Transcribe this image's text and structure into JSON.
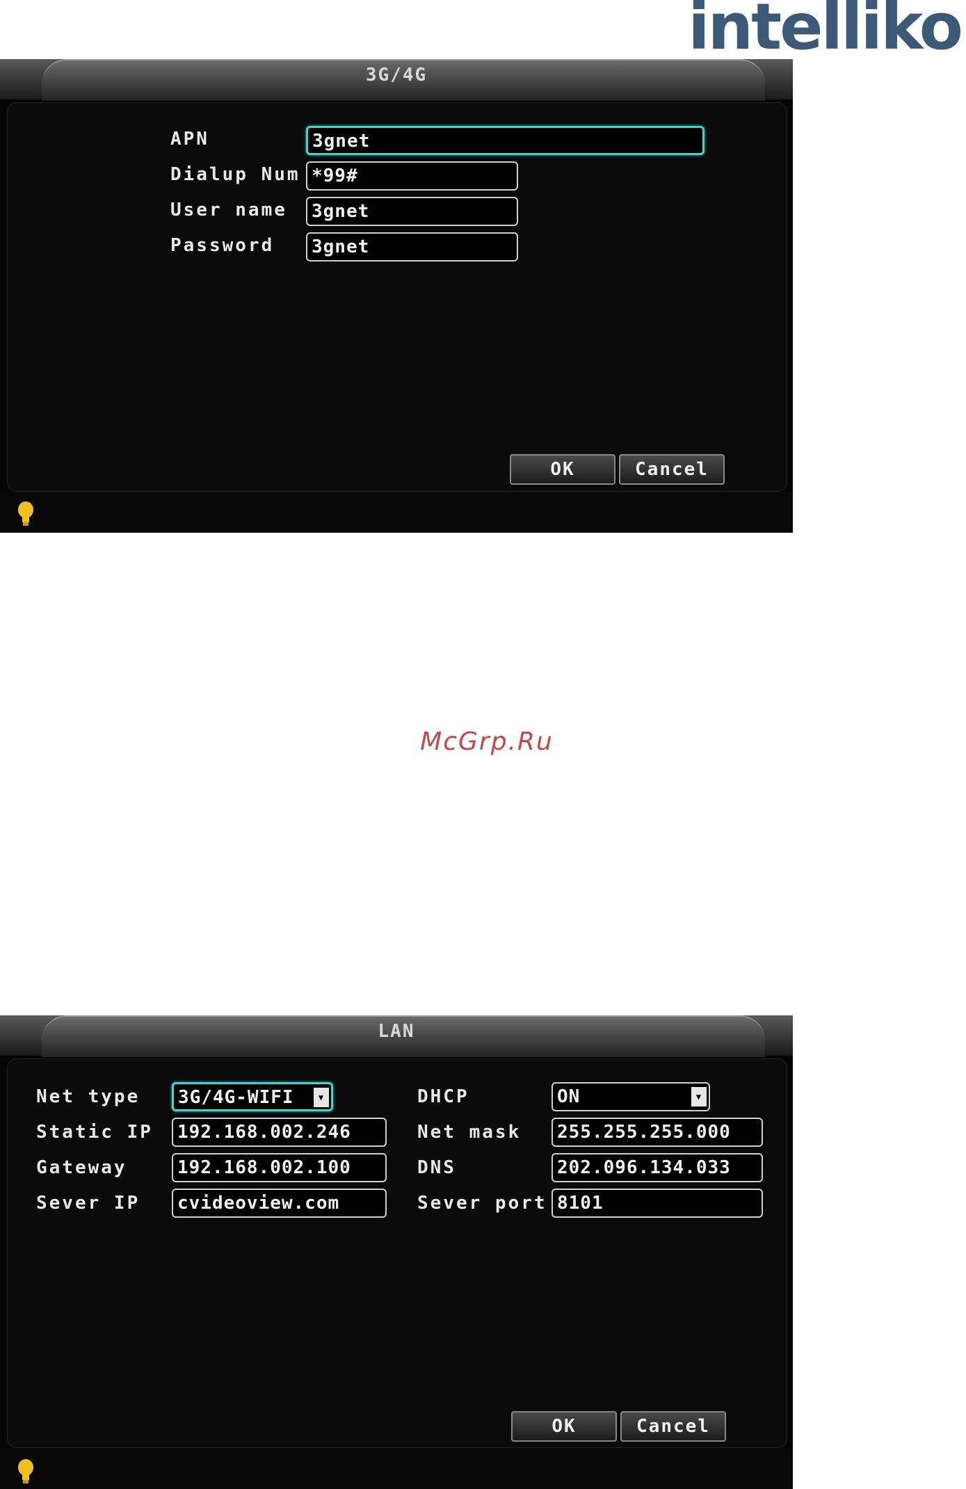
{
  "brand": {
    "logo_text": "intelliko"
  },
  "watermark": "McGrp.Ru",
  "colors": {
    "accent_focus": "#4fd0c4",
    "panel_bg": "#050505",
    "logo": "#3c5a78",
    "watermark": "#c04a4a",
    "hint_icon": "#f0c020"
  },
  "panel_3g4g": {
    "title": "3G/4G",
    "fields": [
      {
        "label": "APN",
        "value": "3gnet"
      },
      {
        "label": "Dialup Num",
        "value": "*99#"
      },
      {
        "label": "User name",
        "value": "3gnet"
      },
      {
        "label": "Password",
        "value": "3gnet"
      }
    ],
    "ok_label": "OK",
    "cancel_label": "Cancel",
    "hint_icon": "lightbulb-icon"
  },
  "panel_lan": {
    "title": "LAN",
    "left_fields": [
      {
        "label": "Net type",
        "value": "3G/4G-WIFI"
      },
      {
        "label": "Static IP",
        "value": "192.168.002.246"
      },
      {
        "label": "Gateway",
        "value": "192.168.002.100"
      },
      {
        "label": "Sever IP",
        "value": "cvideoview.com"
      }
    ],
    "right_fields": [
      {
        "label": "DHCP",
        "value": "ON"
      },
      {
        "label": "Net mask",
        "value": "255.255.255.000"
      },
      {
        "label": "DNS",
        "value": "202.096.134.033"
      },
      {
        "label": "Sever port",
        "value": "8101"
      }
    ],
    "ok_label": "OK",
    "cancel_label": "Cancel",
    "hint_icon": "lightbulb-icon"
  }
}
